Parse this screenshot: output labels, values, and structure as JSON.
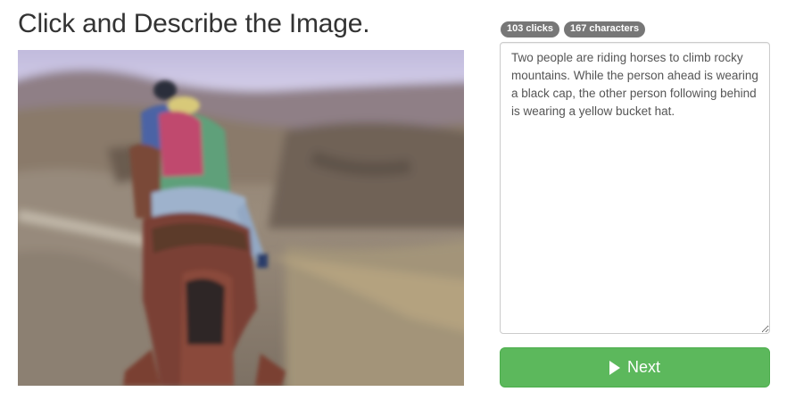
{
  "page": {
    "title": "Click and Describe the Image."
  },
  "image": {
    "subject": "blurred photo of two people riding horses up rocky mountains"
  },
  "stats": {
    "clicks_label": "103 clicks",
    "characters_label": "167 characters"
  },
  "description": {
    "value": "Two people are riding horses to climb rocky mountains. While the person ahead is wearing a black cap, the other person following behind is wearing a yellow bucket hat."
  },
  "actions": {
    "next_label": "Next",
    "next_icon": "play-icon"
  },
  "colors": {
    "badge_bg": "#777777",
    "next_bg": "#5cb85c",
    "text": "#333333"
  }
}
